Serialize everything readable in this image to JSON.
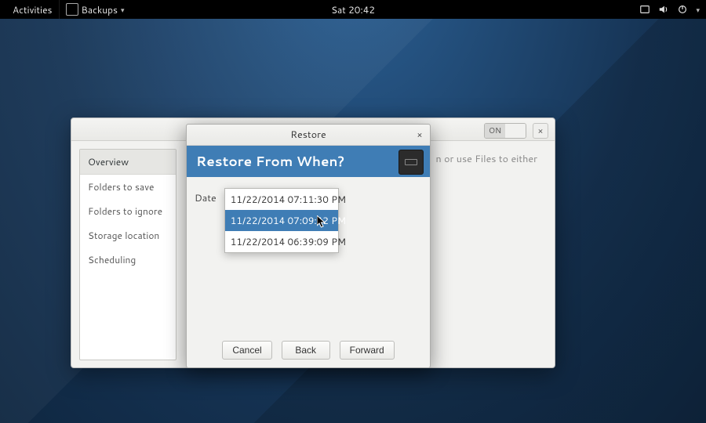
{
  "panel": {
    "activities": "Activities",
    "app_name": "Backups",
    "clock": "Sat 20:42"
  },
  "settings_window": {
    "toggle_on": "ON",
    "close_glyph": "×",
    "sidebar": {
      "items": [
        {
          "label": "Overview"
        },
        {
          "label": "Folders to save"
        },
        {
          "label": "Folders to ignore"
        },
        {
          "label": "Storage location"
        },
        {
          "label": "Scheduling"
        }
      ]
    },
    "hint_tail": "n or use Files to either"
  },
  "restore_dialog": {
    "title": "Restore",
    "close_glyph": "×",
    "heading": "Restore From When?",
    "date_label": "Date",
    "options": [
      "11/22/2014 07:11:30 PM",
      "11/22/2014 07:09:42 PM",
      "11/22/2014 06:39:09 PM"
    ],
    "selected_index": 1,
    "buttons": {
      "cancel": "Cancel",
      "back": "Back",
      "forward": "Forward"
    }
  }
}
